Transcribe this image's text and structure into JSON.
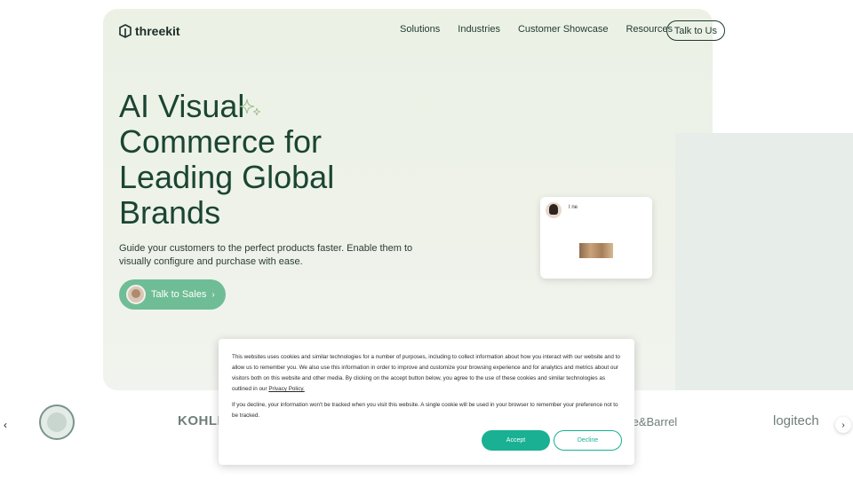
{
  "nav": {
    "logo_text": "threekit",
    "links": [
      "Solutions",
      "Industries",
      "Customer Showcase",
      "Resources"
    ],
    "cta": "Talk to Us"
  },
  "hero": {
    "headline_lines": [
      "AI Visual",
      "Commerce for",
      "Leading Global",
      "Brands"
    ],
    "subtext": "Guide your customers to the perfect products faster. Enable them to visually configure and purchase with ease.",
    "cta": "Talk to Sales",
    "cta_icon": "chevron-right-icon"
  },
  "chat_card": {
    "text": "I ne"
  },
  "logos": {
    "items": [
      "Starbucks",
      "KOHLE",
      "te&Barrel",
      "logitech"
    ],
    "left_arrow": "‹",
    "right_arrow": "›"
  },
  "cookie": {
    "paragraph1": "This websites uses cookies and similar technologies for a number of purposes, including to collect information about how you interact with our website and to allow us to remember you.  We also use this information in order to improve and customize your browsing experience and for analytics and metrics about our visitors both on this website and other media. By clicking on the accept button below, you agree to the use of these cookies and similar technologies as outlined in our",
    "privacy_link": "Privacy Policy.",
    "paragraph2": "If you decline, your information won't be tracked when you visit this website. A single cookie will be used in your browser to remember your preference not to be tracked.",
    "accept": "Accept",
    "decline": "Decline"
  },
  "colors": {
    "brand_green": "#1a4532",
    "cta_green": "#6fbd96",
    "accept_teal": "#19b093",
    "hero_bg": "#ecf1e6"
  }
}
